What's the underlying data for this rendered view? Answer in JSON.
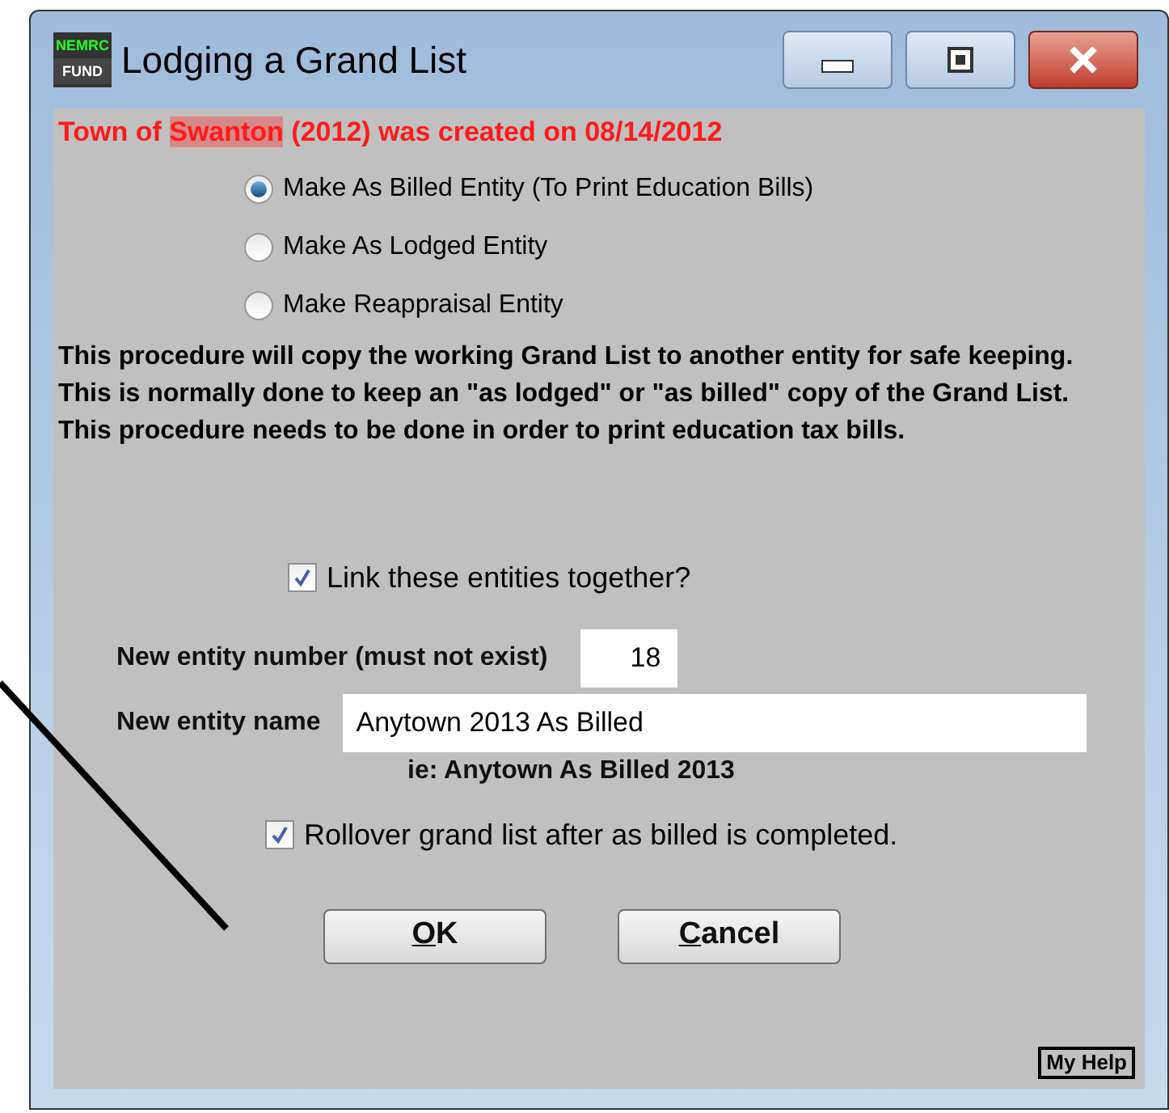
{
  "window": {
    "title": "Lodging a Grand List",
    "logo_top": "NEMRC",
    "logo_bottom": "FUND"
  },
  "notice": {
    "segments": [
      {
        "text": "Town of ",
        "highlighted": false
      },
      {
        "text": "Swanton",
        "highlighted": true
      },
      {
        "text": " (2012) was created on 08/14/2012",
        "highlighted": false
      }
    ]
  },
  "entity_types": [
    {
      "label": "Make As Billed Entity (To Print Education Bills)",
      "selected": true
    },
    {
      "label": "Make As Lodged Entity",
      "selected": false
    },
    {
      "label": "Make Reappraisal Entity",
      "selected": false
    }
  ],
  "description": "This procedure will copy the working Grand List to another entity for safe keeping.  This is normally done to keep an \"as lodged\" or \"as billed\" copy of the Grand List.  This procedure needs to be done in order to print education tax bills.",
  "link_entities": {
    "label": "Link these entities together?",
    "checked": true
  },
  "entity_number": {
    "label": "New entity number (must not exist)",
    "value": "18"
  },
  "entity_name": {
    "label": "New entity name",
    "value": "Anytown 2013 As Billed",
    "hint": "ie: Anytown As Billed 2013"
  },
  "rollover": {
    "label": "Rollover grand list after as billed is completed.",
    "checked": true
  },
  "buttons": [
    "OK",
    "Cancel"
  ],
  "help": "My Help"
}
